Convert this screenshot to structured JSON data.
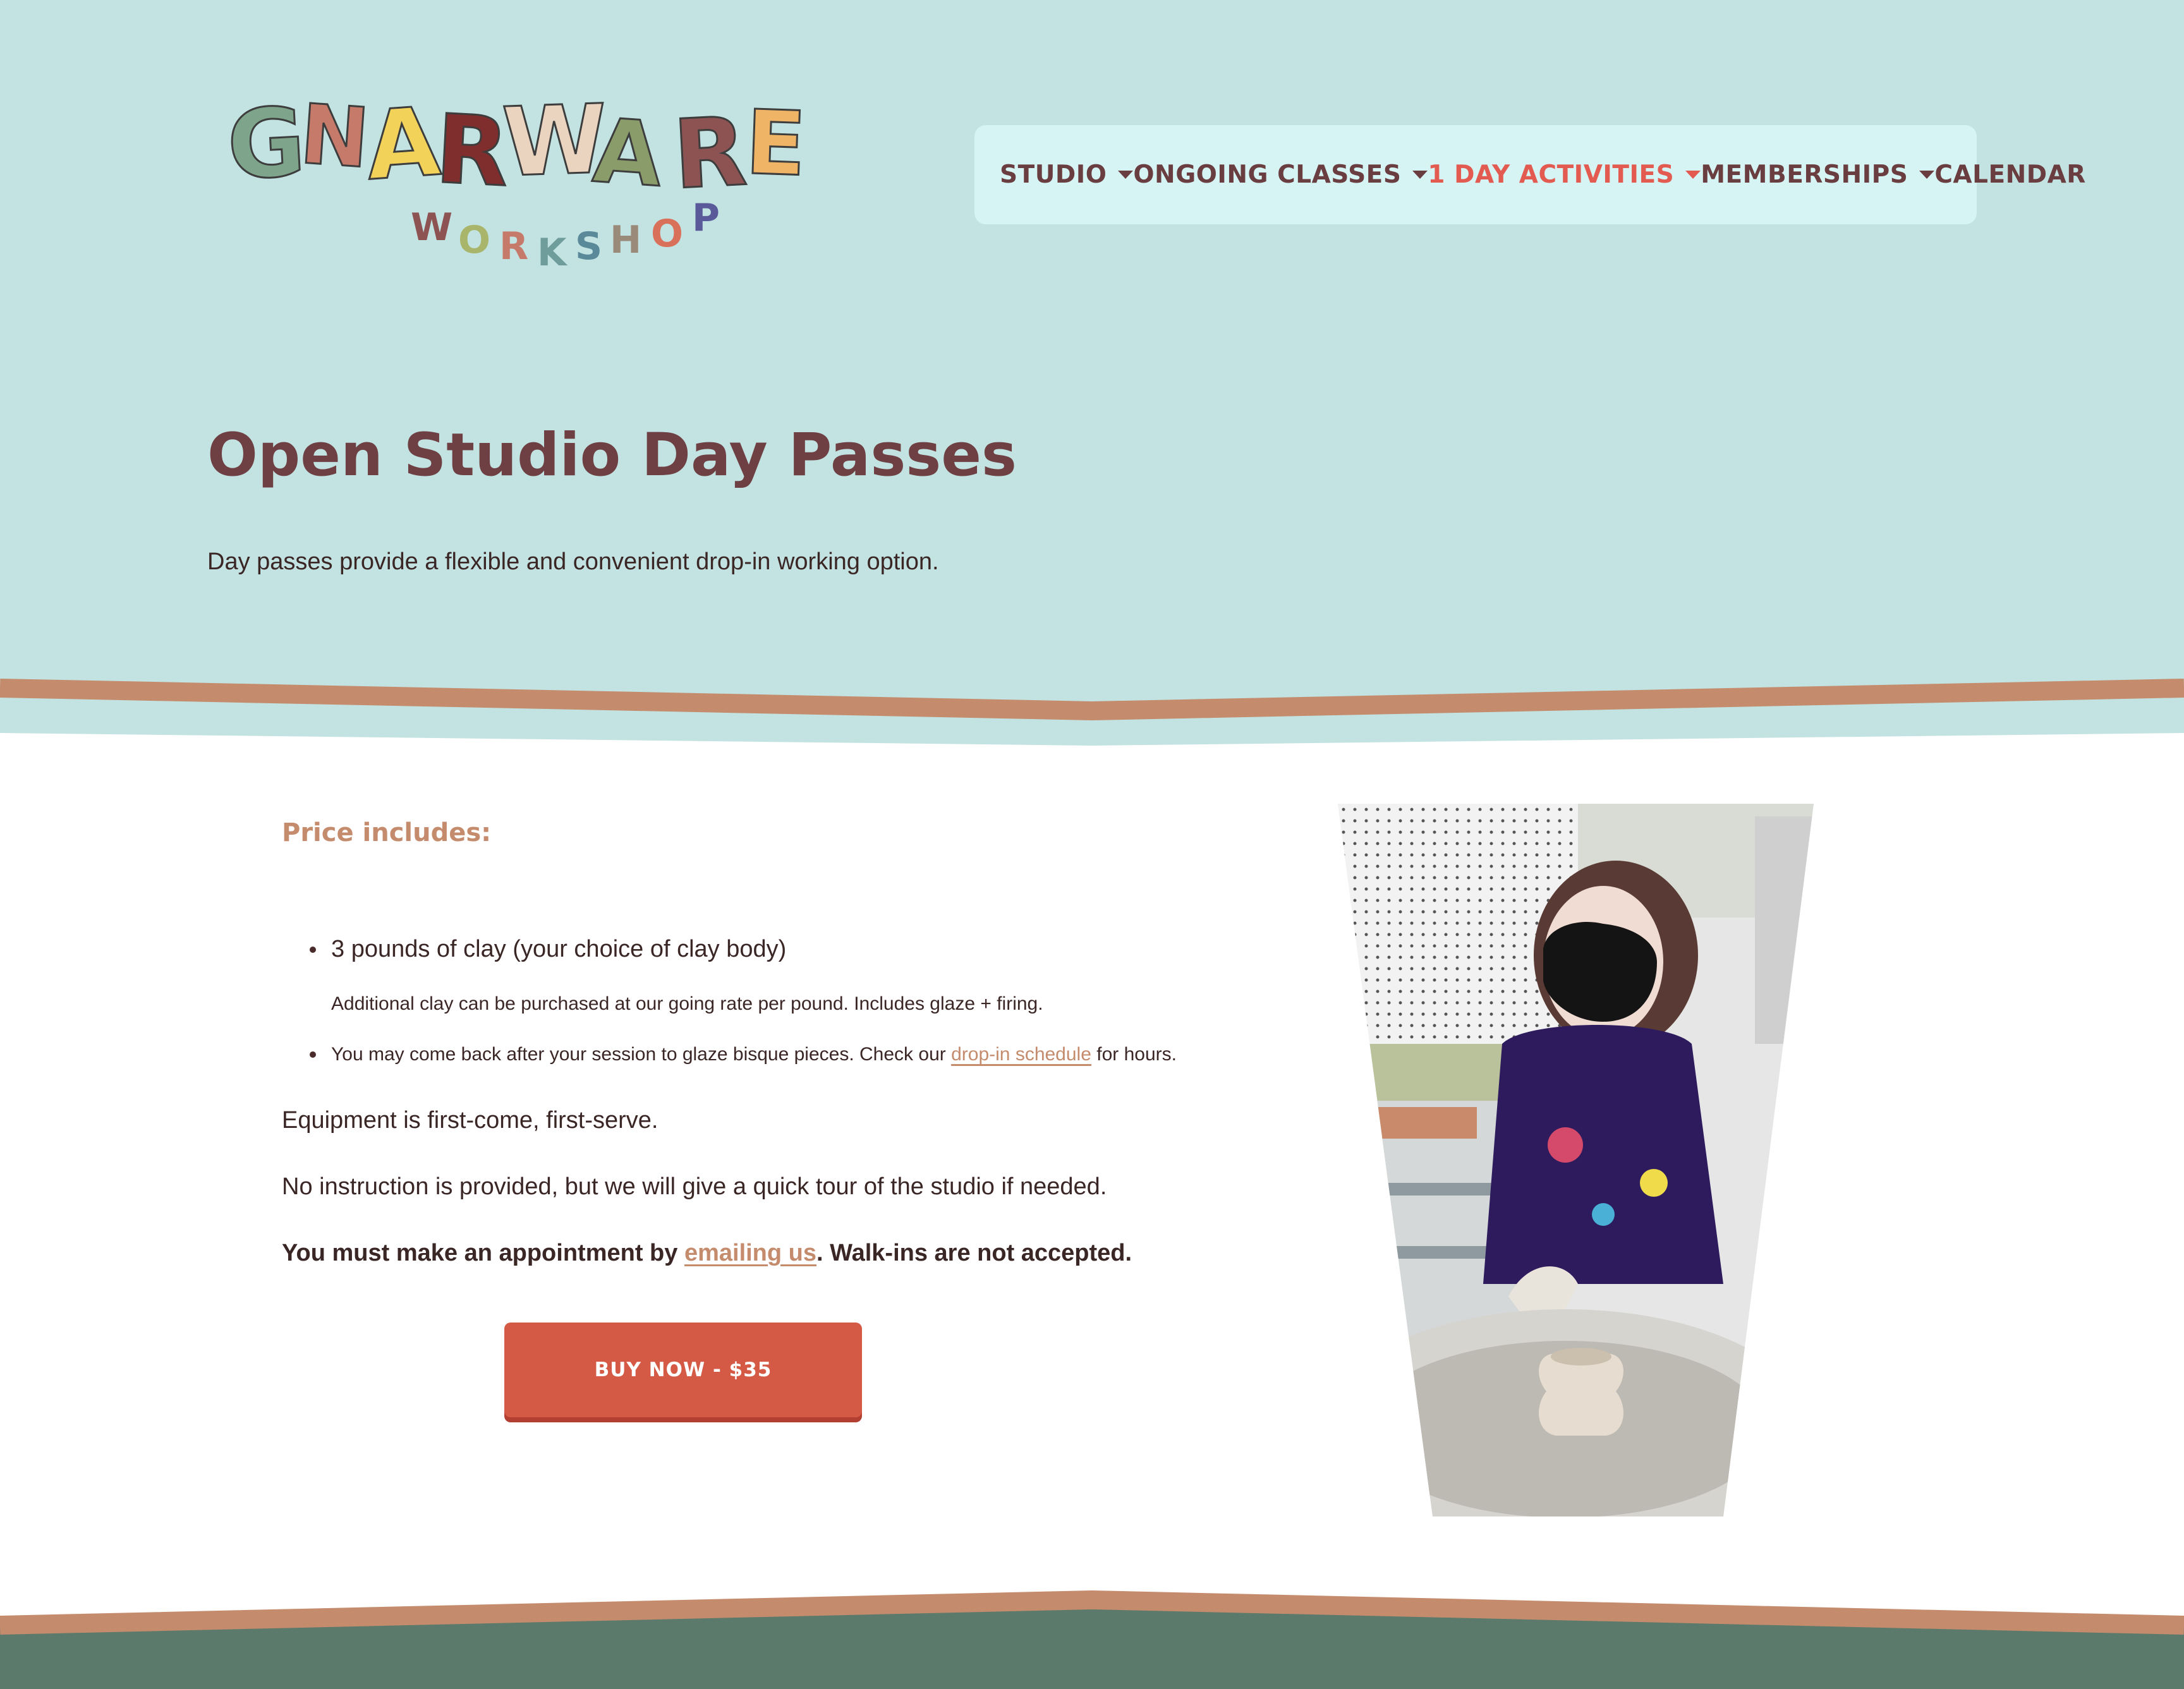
{
  "brand": {
    "logo_text": "GNARWARE",
    "logo_subtext": "WORKSHOP",
    "logo_colors": [
      "#7fa48c",
      "#c67a6a",
      "#f3d25a",
      "#7f2d2d",
      "#ead4c0",
      "#8a9c6a",
      "#8d5353",
      "#f0b466"
    ]
  },
  "nav": {
    "items": [
      {
        "label": "STUDIO",
        "has_dropdown": true,
        "active": false
      },
      {
        "label": "ONGOING CLASSES",
        "has_dropdown": true,
        "active": false
      },
      {
        "label": "1 DAY ACTIVITIES",
        "has_dropdown": true,
        "active": true
      },
      {
        "label": "MEMBERSHIPS",
        "has_dropdown": true,
        "active": false
      },
      {
        "label": "CALENDAR",
        "has_dropdown": false,
        "active": false
      }
    ]
  },
  "hero": {
    "title": "Open Studio Day Passes",
    "subtitle": "Day passes provide a flexible and convenient drop-in working option."
  },
  "content": {
    "section_label": "Price includes:",
    "item1": "3 pounds of clay (your choice of clay body)",
    "item1_note": "Additional clay can be purchased at our going rate per pound. Includes glaze + firing.",
    "item2_before": "You may come back after your session to glaze bisque pieces. Check our ",
    "item2_link": "drop-in schedule",
    "item2_after": " for hours.",
    "para1": "Equipment is first-come, first-serve.",
    "para2": "No instruction is provided, but we will give a quick tour of the studio if needed.",
    "para3_before": "You must make an appointment by ",
    "para3_link": "emailing us",
    "para3_after": ". Walk-ins are not accepted."
  },
  "cta": {
    "label": "BUY NOW - $35"
  },
  "colors": {
    "hero_bg": "#c2e3e1",
    "nav_bg": "#d5f4f3",
    "accent": "#c48b6c",
    "active_nav": "#e25a50",
    "button": "#d55a45",
    "footer": "#5b7a6c",
    "text": "#4a2b2b"
  }
}
